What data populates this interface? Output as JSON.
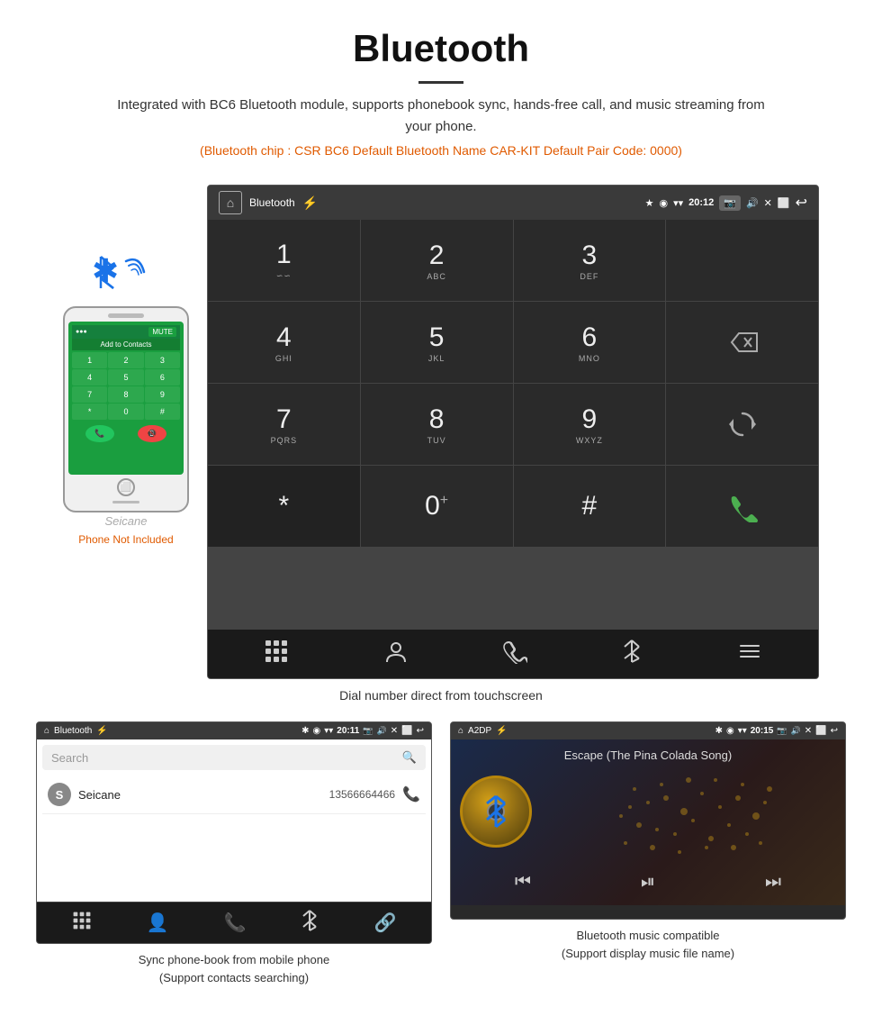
{
  "header": {
    "title": "Bluetooth",
    "description": "Integrated with BC6 Bluetooth module, supports phonebook sync, hands-free call, and music streaming from your phone.",
    "specs": "(Bluetooth chip : CSR BC6    Default Bluetooth Name CAR-KIT    Default Pair Code: 0000)"
  },
  "dial_screen": {
    "status_bar": {
      "label": "Bluetooth",
      "time": "20:12"
    },
    "keys": [
      {
        "number": "1",
        "sub": "∽∽",
        "row": 0,
        "col": 0
      },
      {
        "number": "2",
        "sub": "ABC",
        "row": 0,
        "col": 1
      },
      {
        "number": "3",
        "sub": "DEF",
        "row": 0,
        "col": 2
      },
      {
        "number": "4",
        "sub": "GHI",
        "row": 1,
        "col": 0
      },
      {
        "number": "5",
        "sub": "JKL",
        "row": 1,
        "col": 1
      },
      {
        "number": "6",
        "sub": "MNO",
        "row": 1,
        "col": 2
      },
      {
        "number": "7",
        "sub": "PQRS",
        "row": 2,
        "col": 0
      },
      {
        "number": "8",
        "sub": "TUV",
        "row": 2,
        "col": 1
      },
      {
        "number": "9",
        "sub": "WXYZ",
        "row": 2,
        "col": 2
      },
      {
        "number": "*",
        "sub": "",
        "row": 3,
        "col": 0
      },
      {
        "number": "0",
        "sub": "+",
        "row": 3,
        "col": 1
      },
      {
        "number": "#",
        "sub": "",
        "row": 3,
        "col": 2
      }
    ],
    "caption": "Dial number direct from touchscreen"
  },
  "phonebook_screen": {
    "status_bar": {
      "label": "Bluetooth",
      "time": "20:11"
    },
    "search_placeholder": "Search",
    "contacts": [
      {
        "initial": "S",
        "name": "Seicane",
        "phone": "13566664466"
      }
    ],
    "caption_line1": "Sync phone-book from mobile phone",
    "caption_line2": "(Support contacts searching)"
  },
  "music_screen": {
    "status_bar": {
      "label": "A2DP",
      "time": "20:15"
    },
    "song_title": "Escape (The Pina Colada Song)",
    "caption_line1": "Bluetooth music compatible",
    "caption_line2": "(Support display music file name)"
  },
  "phone_mockup": {
    "not_included": "Phone Not Included"
  }
}
